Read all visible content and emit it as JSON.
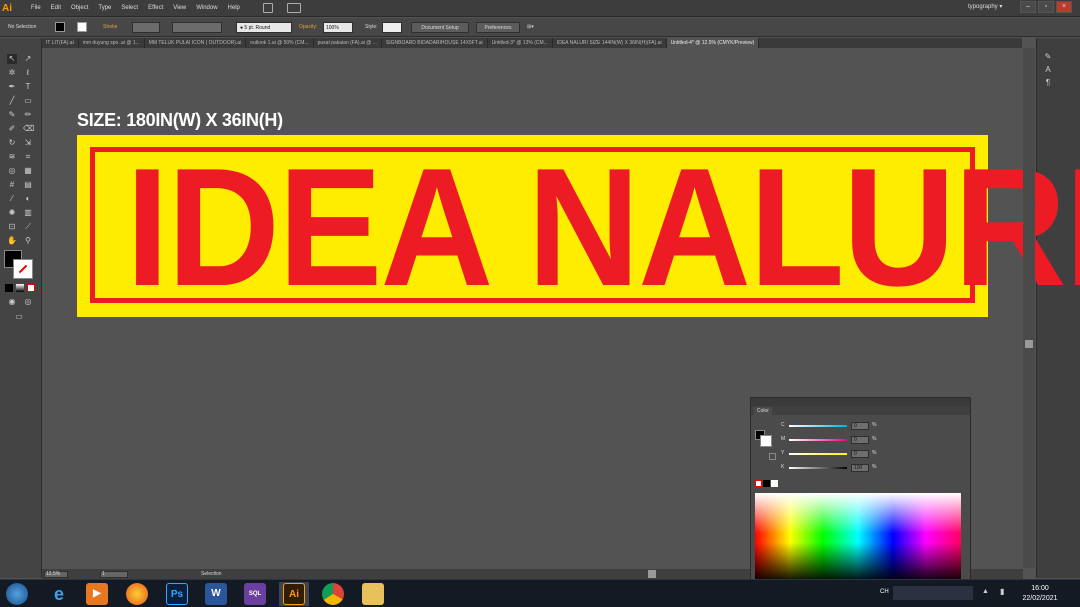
{
  "app": {
    "logo": "Ai",
    "menus": [
      "File",
      "Edit",
      "Object",
      "Type",
      "Select",
      "Effect",
      "View",
      "Window",
      "Help"
    ],
    "workspace": "typography"
  },
  "control": {
    "selection_label": "No Selection",
    "stroke_label": "Stroke",
    "brush": "5 pt. Round",
    "opacity_label": "Opacity:",
    "opacity": "100%",
    "style_label": "Style:",
    "doc_setup": "Document Setup",
    "preferences": "Preferences"
  },
  "tabs": [
    {
      "label": "IT LIT(FA).ai"
    },
    {
      "label": "mm duyung spo..ai @ 1..."
    },
    {
      "label": "MM TELUK PULAI ICON ( OUTDOOR).ai"
    },
    {
      "label": "outlook 1.ai @ 50% (CM..."
    },
    {
      "label": "pusat pakaian (FA).ai @ ..."
    },
    {
      "label": "SIGNBOARD BIDADARIHOUSE 14X5FT.ai"
    },
    {
      "label": "Untitled-3* @ 13% (CM..."
    },
    {
      "label": "IDEA NALURI SIZE 144IN(W) X 36IN(H)(FA).ai"
    },
    {
      "label": "Untitled-4* @ 12.5% (CMYK/Preview)"
    }
  ],
  "artwork": {
    "size_label": "SIZE: 180IN(W) X 36IN(H)",
    "sign_text": "IDEA NALURI",
    "bg_color": "#ffed00",
    "text_color": "#ed1c24"
  },
  "color_panel": {
    "title": "Color",
    "channels": [
      {
        "name": "C",
        "value": "0"
      },
      {
        "name": "M",
        "value": "0"
      },
      {
        "name": "Y",
        "value": "0"
      },
      {
        "name": "K",
        "value": "100"
      }
    ],
    "percent": "%"
  },
  "status": {
    "zoom": "12.5%",
    "page": "1",
    "tool": "Selection"
  },
  "taskbar": {
    "time": "16:00",
    "date": "22/02/2021",
    "lang": "CH"
  }
}
